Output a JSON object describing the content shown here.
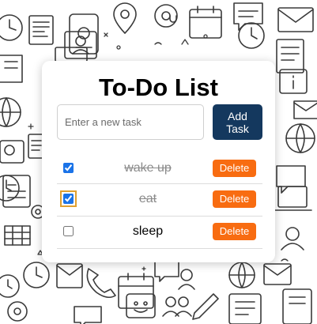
{
  "app": {
    "title": "To-Do List"
  },
  "input": {
    "placeholder": "Enter a new task",
    "value": ""
  },
  "add_button": {
    "label": "Add Task"
  },
  "tasks": [
    {
      "text": "wake up",
      "completed": true,
      "focused": false,
      "delete_label": "Delete"
    },
    {
      "text": "eat",
      "completed": true,
      "focused": true,
      "delete_label": "Delete"
    },
    {
      "text": "sleep",
      "completed": false,
      "focused": false,
      "delete_label": "Delete"
    }
  ],
  "colors": {
    "add_button": "#14385e",
    "delete_button": "#f86c11",
    "completed_text": "#8a8a8a",
    "focus_ring": "#e0a030"
  }
}
